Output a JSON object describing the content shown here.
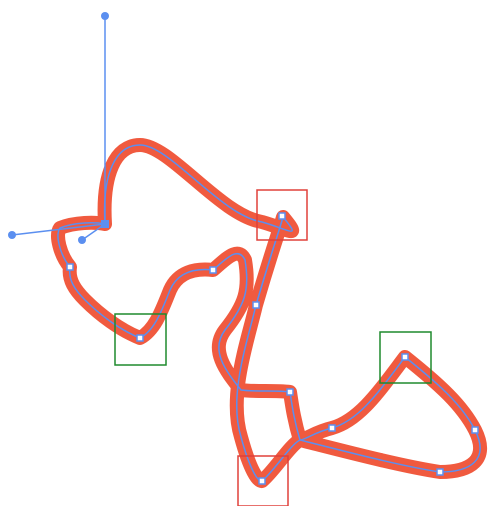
{
  "canvas": {
    "background": "#ffffff"
  },
  "colors": {
    "stroke": "#f05a3f",
    "path": "#5b8ff0",
    "handle": "#5b8ff0",
    "anchor_fill": "#ffffff",
    "anchor_stroke": "#5b8ff0",
    "red_marker": "#e0403a",
    "green_marker": "#1f8a2d"
  },
  "icons": {
    "anchor": "anchor-point-icon",
    "handle": "bezier-handle-icon",
    "red_marker": "red-selection-box",
    "green_marker": "green-selection-box"
  }
}
